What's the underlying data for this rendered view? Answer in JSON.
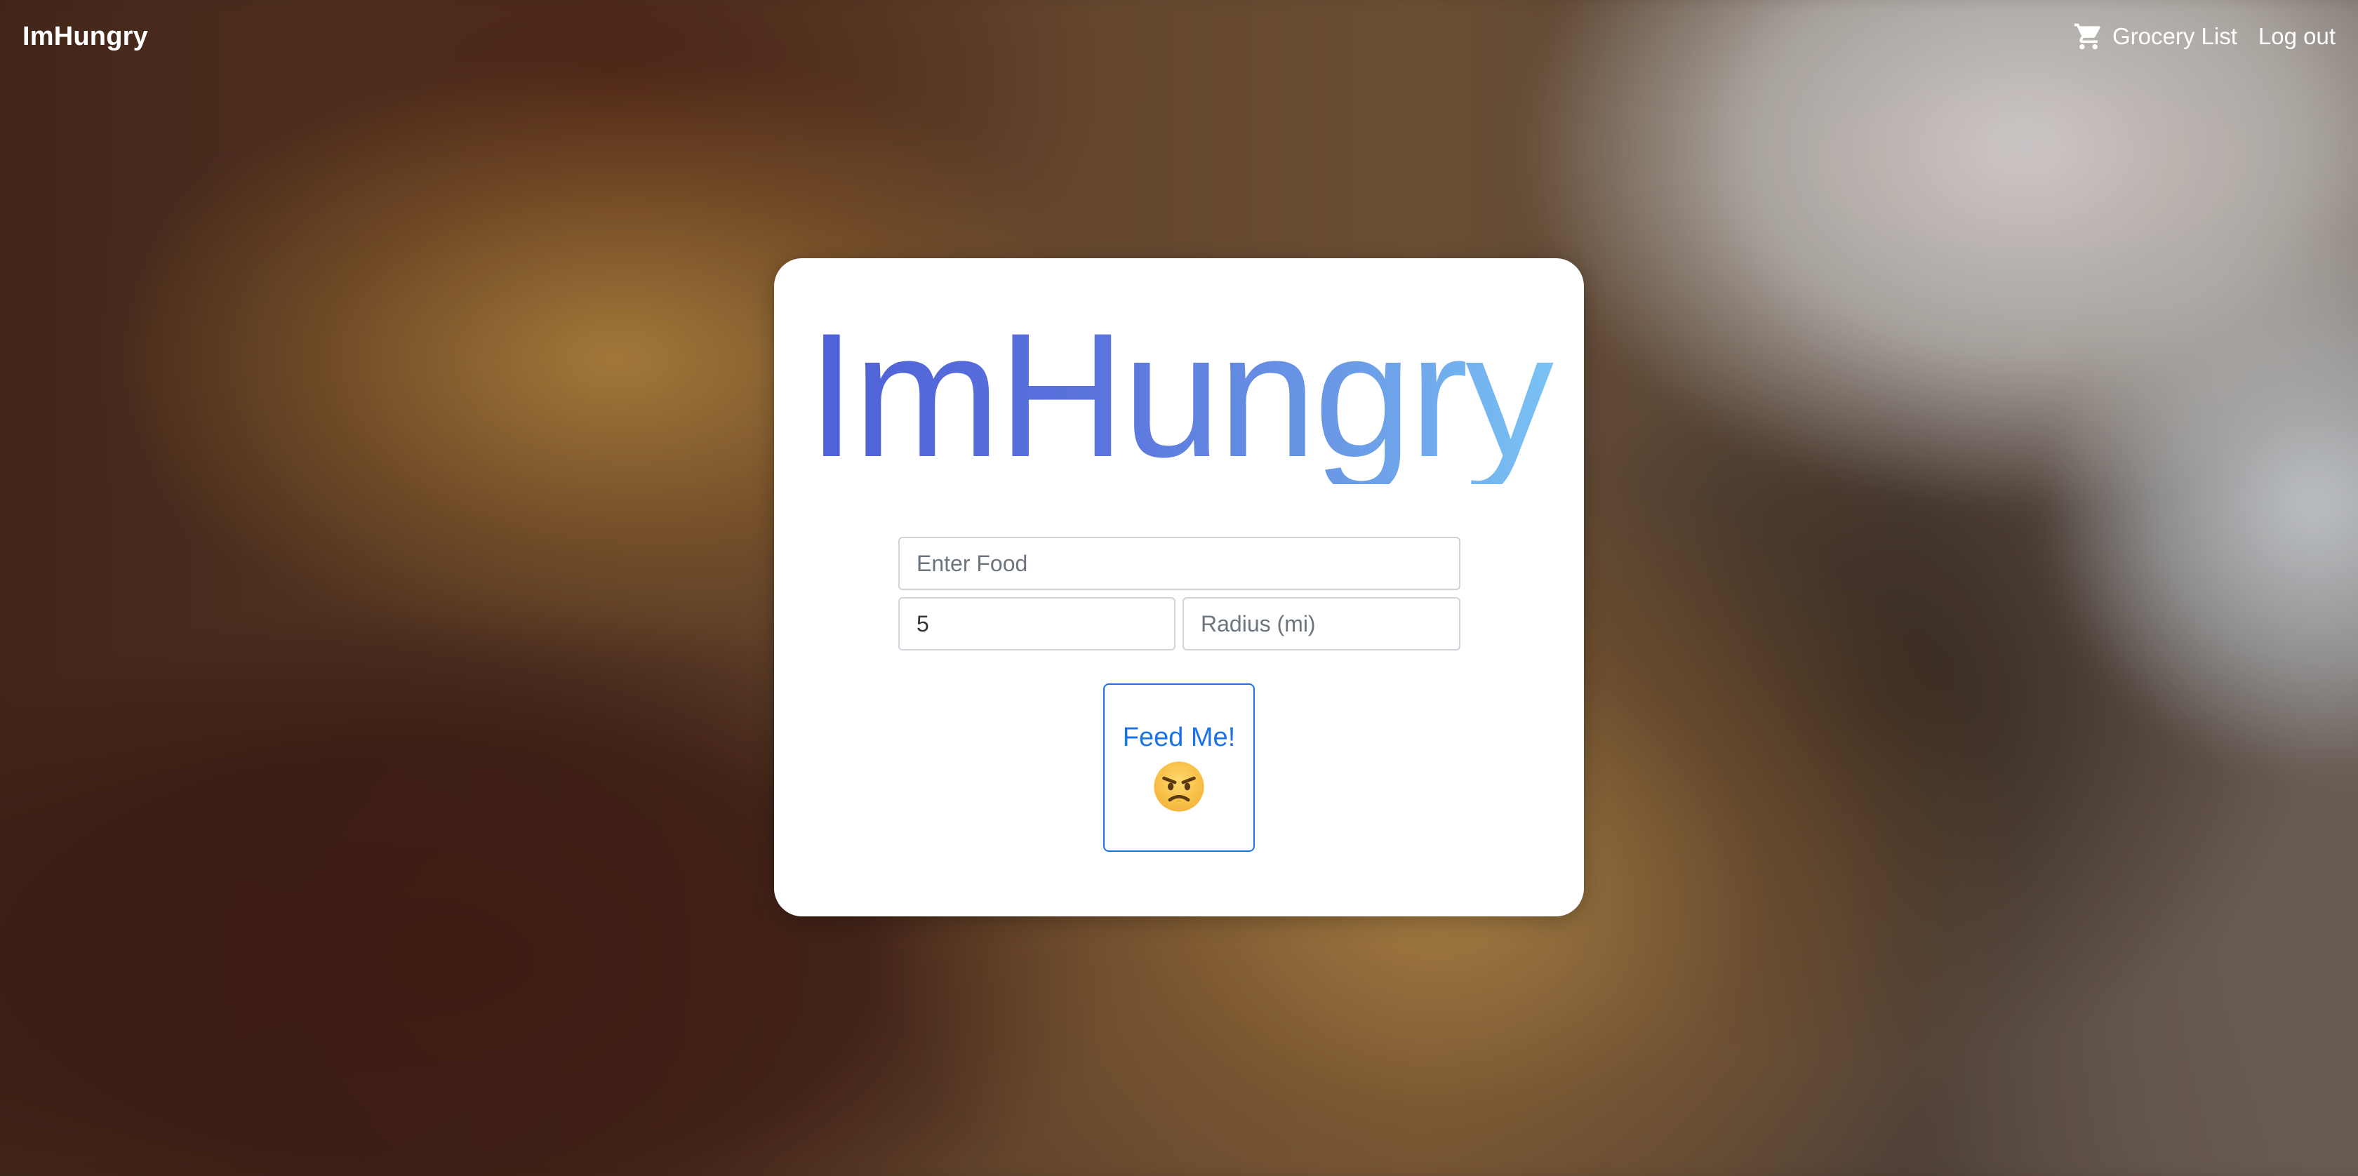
{
  "navbar": {
    "brand": "ImHungry",
    "grocery_list_label": "Grocery List",
    "grocery_icon": "cart-icon",
    "logout_label": "Log out"
  },
  "card": {
    "title": "ImHungry",
    "food_input": {
      "value": "",
      "placeholder": "Enter Food"
    },
    "count_input": {
      "value": "5",
      "placeholder": ""
    },
    "radius_input": {
      "value": "",
      "placeholder": "Radius (mi)"
    },
    "submit_label": "Feed Me!",
    "submit_icon": "angry-face-icon"
  },
  "colors": {
    "title_gradient_start": "#4d5ed6",
    "title_gradient_end": "#7cc8f6",
    "button_accent": "#1a73e8",
    "navbar_text": "#ffffff"
  }
}
